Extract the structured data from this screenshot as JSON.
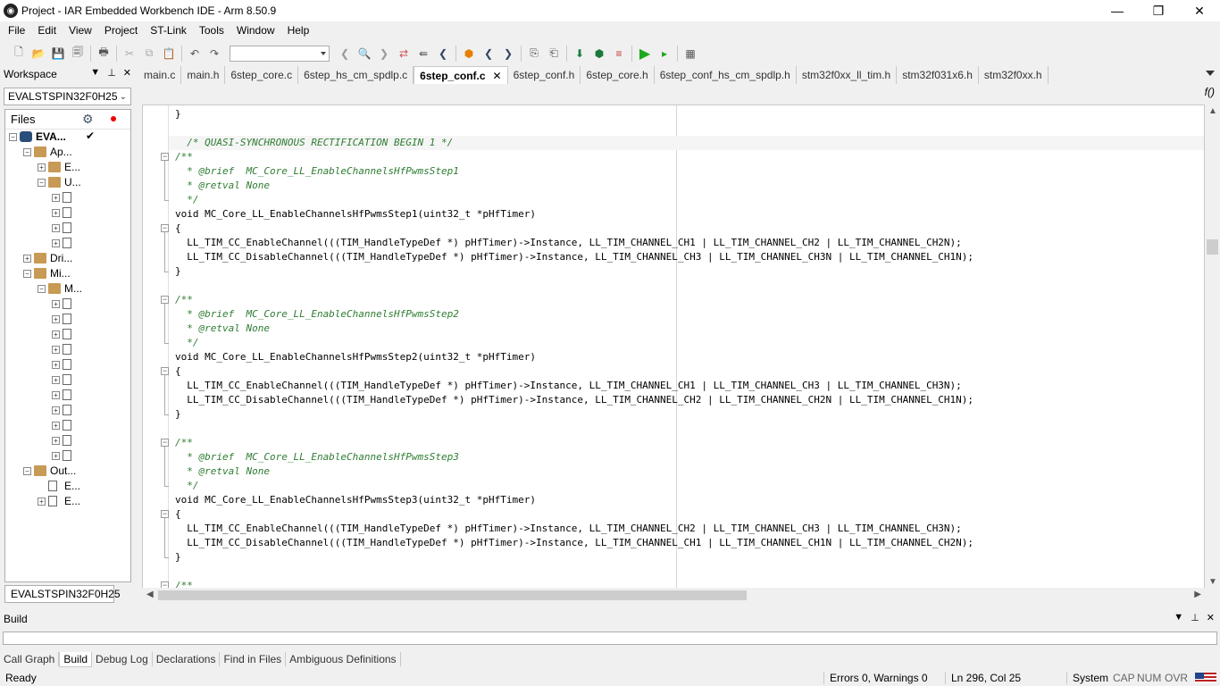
{
  "window": {
    "title": "Project - IAR Embedded Workbench IDE - Arm 8.50.9"
  },
  "menu": [
    "File",
    "Edit",
    "View",
    "Project",
    "ST-Link",
    "Tools",
    "Window",
    "Help"
  ],
  "workspace": {
    "header": "Workspace",
    "config": "EVALSTSPIN32F0H25",
    "files_label": "Files",
    "tree": [
      {
        "label": "EVA...",
        "level": 0,
        "kind": "proj",
        "exp": "−",
        "bold": true,
        "check": "✔"
      },
      {
        "label": "Ap...",
        "level": 1,
        "kind": "folder",
        "exp": "−"
      },
      {
        "label": "E...",
        "level": 2,
        "kind": "folder",
        "exp": "+"
      },
      {
        "label": "U...",
        "level": 2,
        "kind": "folder",
        "exp": "−"
      },
      {
        "label": "",
        "level": 3,
        "kind": "file",
        "exp": "+"
      },
      {
        "label": "",
        "level": 3,
        "kind": "file",
        "exp": "+"
      },
      {
        "label": "",
        "level": 3,
        "kind": "file",
        "exp": "+"
      },
      {
        "label": "",
        "level": 3,
        "kind": "file",
        "exp": "+"
      },
      {
        "label": "Dri...",
        "level": 1,
        "kind": "folder",
        "exp": "+"
      },
      {
        "label": "Mi...",
        "level": 1,
        "kind": "folder",
        "exp": "−"
      },
      {
        "label": "M...",
        "level": 2,
        "kind": "folder",
        "exp": "−"
      },
      {
        "label": "",
        "level": 3,
        "kind": "file",
        "exp": "+"
      },
      {
        "label": "",
        "level": 3,
        "kind": "file",
        "exp": "+"
      },
      {
        "label": "",
        "level": 3,
        "kind": "file",
        "exp": "+"
      },
      {
        "label": "",
        "level": 3,
        "kind": "file",
        "exp": "+"
      },
      {
        "label": "",
        "level": 3,
        "kind": "file",
        "exp": "+"
      },
      {
        "label": "",
        "level": 3,
        "kind": "file",
        "exp": "+"
      },
      {
        "label": "",
        "level": 3,
        "kind": "file",
        "exp": "+"
      },
      {
        "label": "",
        "level": 3,
        "kind": "file",
        "exp": "+"
      },
      {
        "label": "",
        "level": 3,
        "kind": "file",
        "exp": "+"
      },
      {
        "label": "",
        "level": 3,
        "kind": "file",
        "exp": "+"
      },
      {
        "label": "",
        "level": 3,
        "kind": "file",
        "exp": "+"
      },
      {
        "label": "Out...",
        "level": 1,
        "kind": "folder",
        "exp": "−"
      },
      {
        "label": "E...",
        "level": 2,
        "kind": "file",
        "exp": ""
      },
      {
        "label": "E...",
        "level": 2,
        "kind": "file",
        "exp": "+"
      }
    ],
    "bottom_tab": "EVALSTSPIN32F0H25"
  },
  "editor": {
    "tabs": [
      {
        "label": "main.c",
        "active": false
      },
      {
        "label": "main.h",
        "active": false
      },
      {
        "label": "6step_core.c",
        "active": false
      },
      {
        "label": "6step_hs_cm_spdlp.c",
        "active": false
      },
      {
        "label": "6step_conf.c",
        "active": true
      },
      {
        "label": "6step_conf.h",
        "active": false
      },
      {
        "label": "6step_core.h",
        "active": false
      },
      {
        "label": "6step_conf_hs_cm_spdlp.h",
        "active": false
      },
      {
        "label": "stm32f0xx_ll_tim.h",
        "active": false
      },
      {
        "label": "stm32f031x6.h",
        "active": false
      },
      {
        "label": "stm32f0xx.h",
        "active": false
      }
    ],
    "func_btn": "f()",
    "lines": [
      {
        "text": "}",
        "type": "code"
      },
      {
        "text": "",
        "type": "code"
      },
      {
        "text": "  /* QUASI-SYNCHRONOUS RECTIFICATION BEGIN 1 */",
        "type": "cmt",
        "hl": true
      },
      {
        "text": "/**",
        "type": "cmt",
        "fold": "−"
      },
      {
        "text": "  * @brief  MC_Core_LL_EnableChannelsHfPwmsStep1",
        "type": "cmt"
      },
      {
        "text": "  * @retval None",
        "type": "cmt"
      },
      {
        "text": "  */",
        "type": "cmt"
      },
      {
        "text": "void MC_Core_LL_EnableChannelsHfPwmsStep1(uint32_t *pHfTimer)",
        "type": "code"
      },
      {
        "text": "{",
        "type": "code",
        "fold": "−"
      },
      {
        "text": "  LL_TIM_CC_EnableChannel(((TIM_HandleTypeDef *) pHfTimer)->Instance, LL_TIM_CHANNEL_CH1 | LL_TIM_CHANNEL_CH2 | LL_TIM_CHANNEL_CH2N);",
        "type": "code"
      },
      {
        "text": "  LL_TIM_CC_DisableChannel(((TIM_HandleTypeDef *) pHfTimer)->Instance, LL_TIM_CHANNEL_CH3 | LL_TIM_CHANNEL_CH3N | LL_TIM_CHANNEL_CH1N);",
        "type": "code"
      },
      {
        "text": "}",
        "type": "code"
      },
      {
        "text": "",
        "type": "code"
      },
      {
        "text": "/**",
        "type": "cmt",
        "fold": "−"
      },
      {
        "text": "  * @brief  MC_Core_LL_EnableChannelsHfPwmsStep2",
        "type": "cmt"
      },
      {
        "text": "  * @retval None",
        "type": "cmt"
      },
      {
        "text": "  */",
        "type": "cmt"
      },
      {
        "text": "void MC_Core_LL_EnableChannelsHfPwmsStep2(uint32_t *pHfTimer)",
        "type": "code"
      },
      {
        "text": "{",
        "type": "code",
        "fold": "−"
      },
      {
        "text": "  LL_TIM_CC_EnableChannel(((TIM_HandleTypeDef *) pHfTimer)->Instance, LL_TIM_CHANNEL_CH1 | LL_TIM_CHANNEL_CH3 | LL_TIM_CHANNEL_CH3N);",
        "type": "code"
      },
      {
        "text": "  LL_TIM_CC_DisableChannel(((TIM_HandleTypeDef *) pHfTimer)->Instance, LL_TIM_CHANNEL_CH2 | LL_TIM_CHANNEL_CH2N | LL_TIM_CHANNEL_CH1N);",
        "type": "code"
      },
      {
        "text": "}",
        "type": "code"
      },
      {
        "text": "",
        "type": "code"
      },
      {
        "text": "/**",
        "type": "cmt",
        "fold": "−"
      },
      {
        "text": "  * @brief  MC_Core_LL_EnableChannelsHfPwmsStep3",
        "type": "cmt"
      },
      {
        "text": "  * @retval None",
        "type": "cmt"
      },
      {
        "text": "  */",
        "type": "cmt"
      },
      {
        "text": "void MC_Core_LL_EnableChannelsHfPwmsStep3(uint32_t *pHfTimer)",
        "type": "code"
      },
      {
        "text": "{",
        "type": "code",
        "fold": "−"
      },
      {
        "text": "  LL_TIM_CC_EnableChannel(((TIM_HandleTypeDef *) pHfTimer)->Instance, LL_TIM_CHANNEL_CH2 | LL_TIM_CHANNEL_CH3 | LL_TIM_CHANNEL_CH3N);",
        "type": "code"
      },
      {
        "text": "  LL_TIM_CC_DisableChannel(((TIM_HandleTypeDef *) pHfTimer)->Instance, LL_TIM_CHANNEL_CH1 | LL_TIM_CHANNEL_CH1N | LL_TIM_CHANNEL_CH2N);",
        "type": "code"
      },
      {
        "text": "}",
        "type": "code"
      },
      {
        "text": "",
        "type": "code"
      },
      {
        "text": "/**",
        "type": "cmt",
        "fold": "−"
      }
    ]
  },
  "build": {
    "header": "Build",
    "tabs": [
      {
        "label": "Call Graph",
        "active": false
      },
      {
        "label": "Build",
        "active": true
      },
      {
        "label": "Debug Log",
        "active": false
      },
      {
        "label": "Declarations",
        "active": false
      },
      {
        "label": "Find in Files",
        "active": false
      },
      {
        "label": "Ambiguous Definitions",
        "active": false
      }
    ]
  },
  "status": {
    "ready": "Ready",
    "errors": "Errors 0, Warnings 0",
    "position": "Ln 296, Col 25",
    "system": "System",
    "cap": "CAP",
    "num": "NUM",
    "ovr": "OVR"
  },
  "colors": {
    "comment": "#2e7d32",
    "run_green": "#1ea81e",
    "accent": "#2a4e7a"
  },
  "icons": [
    "new-file-icon",
    "open-icon",
    "save-icon",
    "save-all-icon",
    "print-icon",
    "cut-icon",
    "copy-icon",
    "paste-icon",
    "undo-icon",
    "redo-icon",
    "back-icon",
    "find-icon",
    "forward-icon",
    "toggle-bookmark-icon",
    "prev-bookmark-icon",
    "next-bookmark-icon",
    "breakpoint-icon",
    "prev-icon",
    "next-icon",
    "compile-icon",
    "make-icon",
    "download-icon",
    "stop-build-icon",
    "debug-icon",
    "debug-nodownload-icon",
    "run-icon",
    "options-icon"
  ]
}
